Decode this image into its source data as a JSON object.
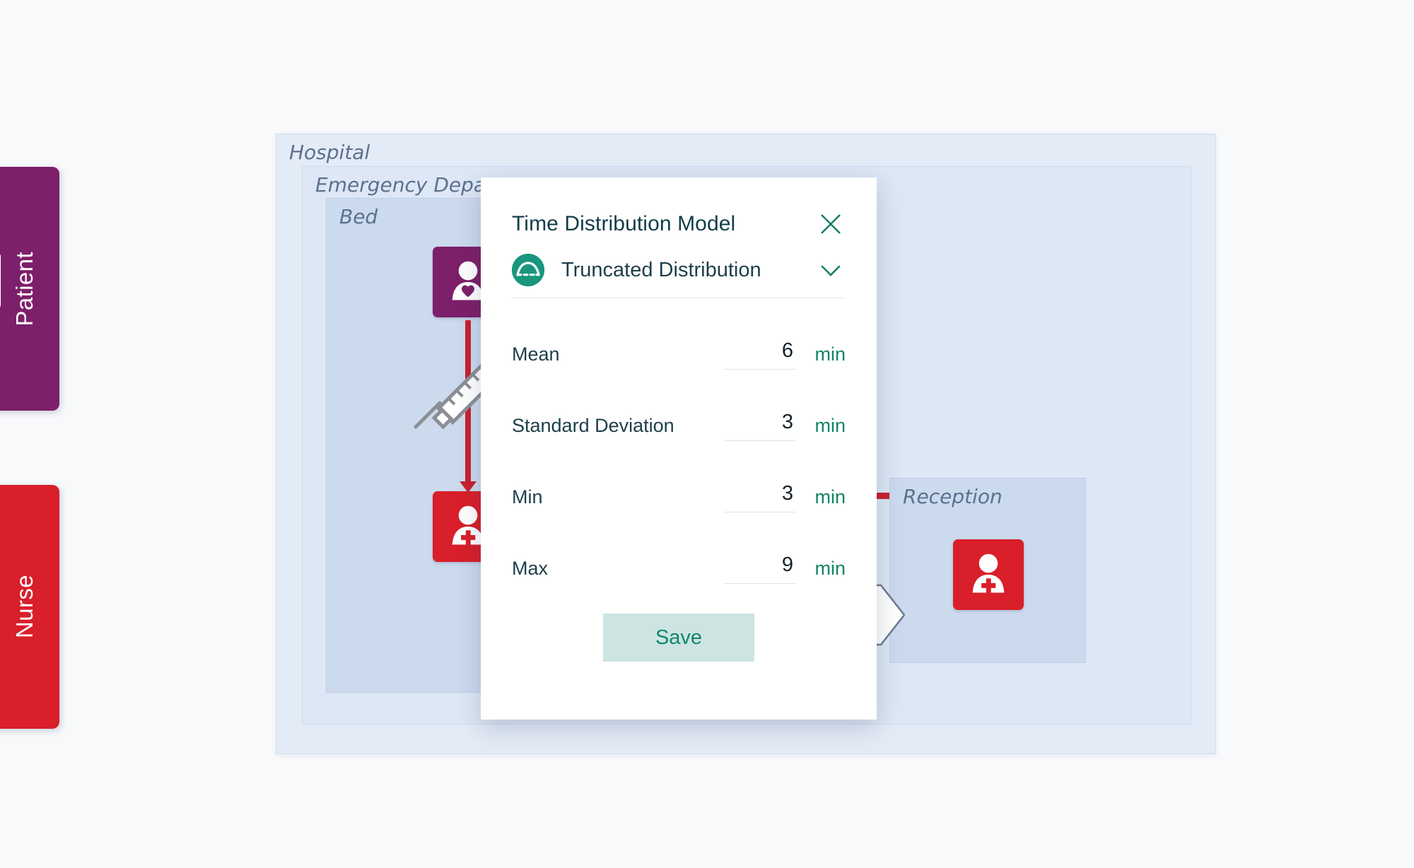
{
  "resource_tabs": [
    {
      "label": "Patient",
      "color": "#7d1f6a"
    },
    {
      "label": "Nurse",
      "color": "#d81f2a"
    }
  ],
  "zones": {
    "hospital": {
      "label": "Hospital"
    },
    "emergency": {
      "label": "Emergency Department"
    },
    "bed": {
      "label": "Bed"
    },
    "reception": {
      "label": "Reception"
    }
  },
  "actors": {
    "patient_in_bed": {
      "name": "Patient",
      "color": "#7d1f6a"
    },
    "nurse_in_bed": {
      "name": "Nurse",
      "color": "#d81f2a"
    },
    "nurse_reception": {
      "name": "Nurse",
      "color": "#d81f2a"
    }
  },
  "connectors": {
    "injection": {
      "icon": "syringe-icon",
      "color": "#d81f2a"
    },
    "to_reception": {
      "color": "#c8202f"
    }
  },
  "modal": {
    "title": "Time Distribution Model",
    "close_label": "✕",
    "distribution": {
      "name": "Truncated Distribution",
      "icon": "bell-curve-icon",
      "accent": "#18967e",
      "chevron": "chevron-down-icon"
    },
    "fields": [
      {
        "label": "Mean",
        "value": "6",
        "unit": "min"
      },
      {
        "label": "Standard Deviation",
        "value": "3",
        "unit": "min"
      },
      {
        "label": "Min",
        "value": "3",
        "unit": "min"
      },
      {
        "label": "Max",
        "value": "9",
        "unit": "min"
      }
    ],
    "save_label": "Save",
    "accent_color": "#12876c",
    "button_bg": "#cde4e3"
  }
}
